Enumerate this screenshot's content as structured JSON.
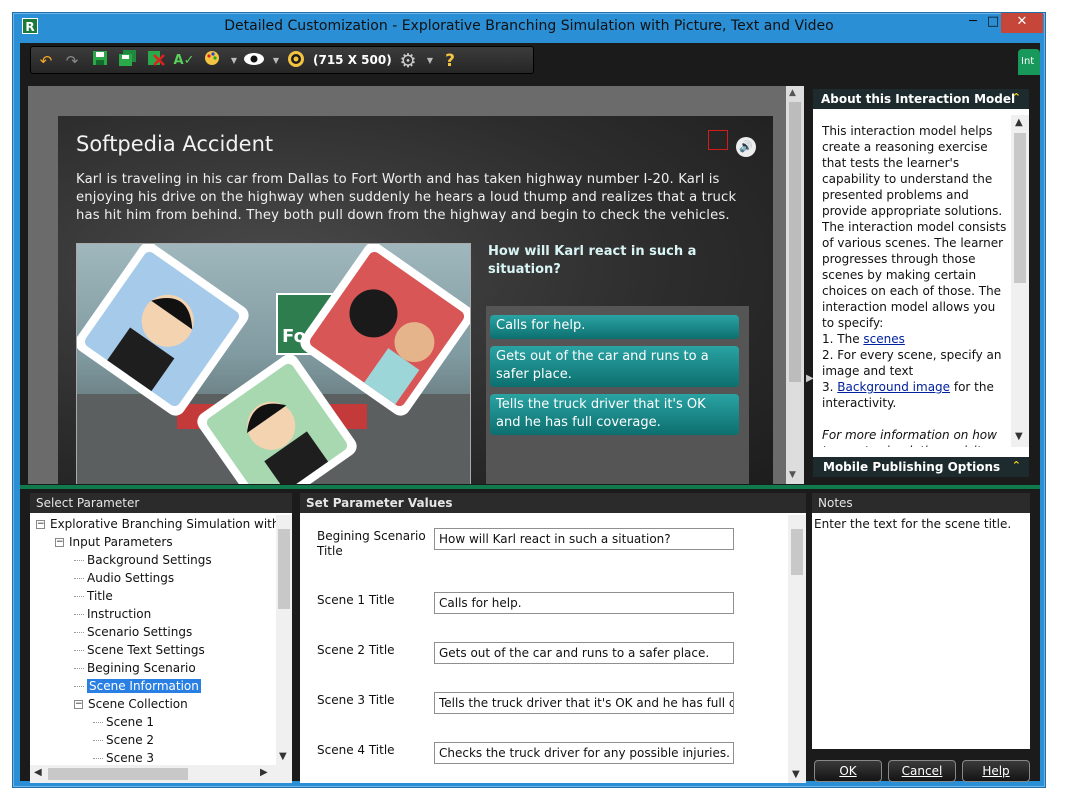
{
  "window": {
    "title": "Detailed Customization - Explorative Branching Simulation with Picture, Text and Video",
    "app_icon": "R",
    "minimize": "─",
    "maximize": "□",
    "close": "✕"
  },
  "toolbar": {
    "resolution": "(715 X 500)",
    "help": "?",
    "right_tab": "Int"
  },
  "slide": {
    "title": "Softpedia Accident",
    "paragraph": "Karl is traveling in his car from Dallas to Fort Worth and has taken highway number I-20. Karl is enjoying his drive on the highway when suddenly he hears a loud thump and realizes that a truck has hit him from behind. They both pull down from the highway and begin to check the vehicles.",
    "sign_text": "Fo",
    "question": "How will Karl react in such a situation?",
    "choices": [
      "Calls for help.",
      "Gets out of the car and runs to a safer place.",
      "Tells the truck driver that it's OK and he has full coverage."
    ]
  },
  "about": {
    "header": "About this Interaction Model",
    "p1": "This interaction model helps create a reasoning exercise that tests the learner's capability to understand the presented problems and provide appropriate solutions. The interaction model consists of various scenes. The learner progresses through those scenes by making certain choices on each of those. The interaction model allows you to specify:",
    "item1_prefix": "1. The ",
    "item1_link": "scenes",
    "item2": "2. For every scene, specify an image and text",
    "item3_prefix": "3. ",
    "item3_link": "Background image",
    "item3_suffix": " for the interactivity.",
    "more": "For more information on how to create simulations, visit",
    "mobile_header": "Mobile Publishing Options"
  },
  "select_parameter": {
    "header": "Select Parameter",
    "items": [
      {
        "label": "Explorative Branching Simulation with Pi",
        "level": 0,
        "toggle": "−"
      },
      {
        "label": "Input Parameters",
        "level": 1,
        "toggle": "−"
      },
      {
        "label": "Background Settings",
        "level": 2
      },
      {
        "label": "Audio Settings",
        "level": 2
      },
      {
        "label": "Title",
        "level": 2
      },
      {
        "label": "Instruction",
        "level": 2
      },
      {
        "label": "Scenario Settings",
        "level": 2
      },
      {
        "label": "Scene Text Settings",
        "level": 2
      },
      {
        "label": "Begining Scenario",
        "level": 2
      },
      {
        "label": "Scene Information",
        "level": 2,
        "selected": true
      },
      {
        "label": "Scene Collection",
        "level": 2,
        "toggle": "−"
      },
      {
        "label": "Scene 1",
        "level": 3
      },
      {
        "label": "Scene 2",
        "level": 3
      },
      {
        "label": "Scene 3",
        "level": 3
      }
    ]
  },
  "set_values": {
    "header": "Set Parameter Values",
    "fields": [
      {
        "label": "Begining Scenario Title",
        "value": "How will Karl react in such a situation?"
      },
      {
        "label": "Scene 1 Title",
        "value": "Calls for help."
      },
      {
        "label": "Scene 2 Title",
        "value": "Gets out of the car and runs to a safer place."
      },
      {
        "label": "Scene 3 Title",
        "value": "Tells the truck driver that it's OK and he has full coverage."
      },
      {
        "label": "Scene 4 Title",
        "value": "Checks the truck driver for any possible injuries."
      }
    ]
  },
  "notes": {
    "header": "Notes",
    "text": "Enter the text for the scene title."
  },
  "buttons": {
    "ok": "OK",
    "cancel": "Cancel",
    "help": "Help"
  }
}
